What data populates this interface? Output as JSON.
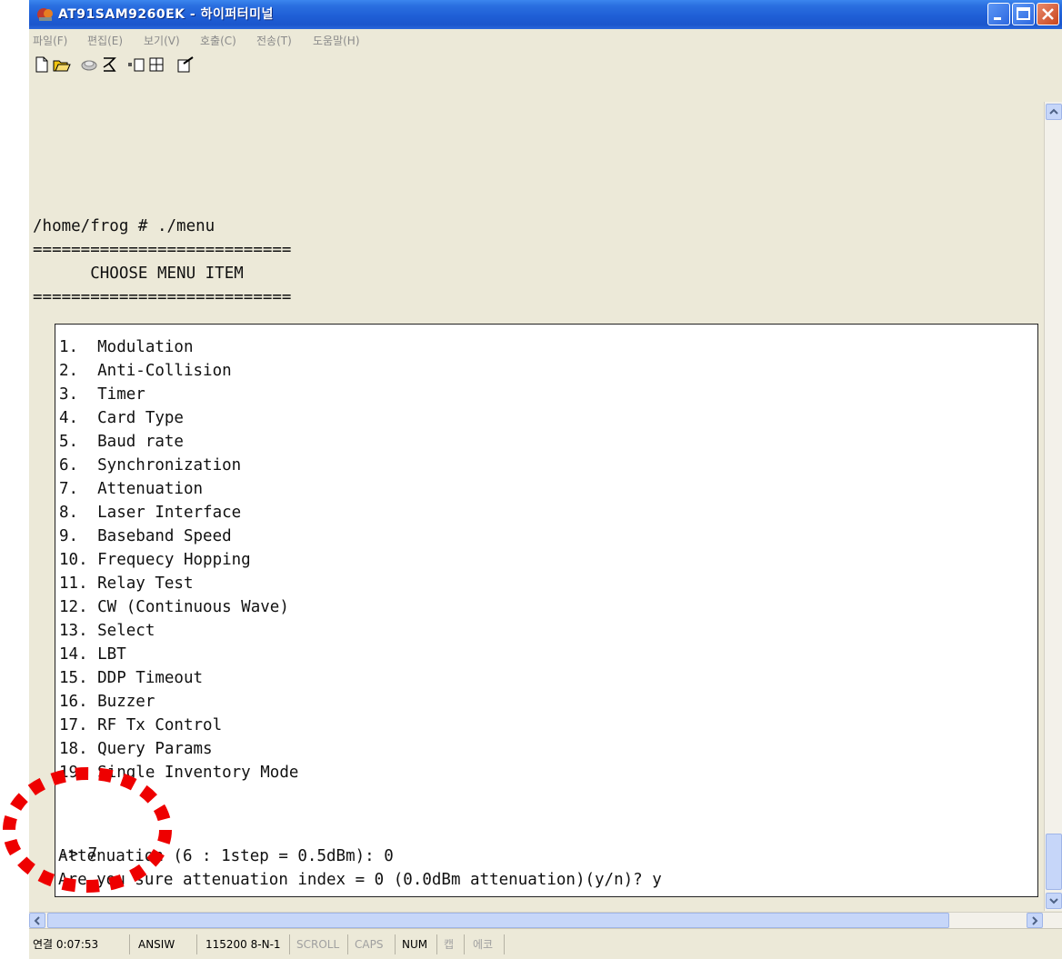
{
  "window": {
    "title": "AT91SAM9260EK - 하이퍼터미널",
    "colors": {
      "titlebar": "#1f5fd6",
      "annotation": "#ee0000"
    }
  },
  "menubar": [
    "파일(F)",
    "편집(E)",
    "보기(V)",
    "호출(C)",
    "전송(T)",
    "도움말(H)"
  ],
  "toolbar": [
    "new-icon",
    "open-icon",
    "disconnect-icon",
    "connect-icon",
    "send-icon",
    "receive-icon",
    "properties-icon"
  ],
  "terminal": {
    "header_lines": [
      "/home/frog # ./menu",
      "===========================",
      "      CHOOSE MENU ITEM",
      "==========================="
    ],
    "menu_items": [
      "1.  Modulation",
      "2.  Anti-Collision",
      "3.  Timer",
      "4.  Card Type",
      "5.  Baud rate",
      "6.  Synchronization",
      "7.  Attenuation",
      "8.  Laser Interface",
      "9.  Baseband Speed",
      "10. Frequecy Hopping",
      "11. Relay Test",
      "12. CW (Continuous Wave)",
      "13. Select",
      "14. LBT",
      "15. DDP Timeout",
      "16. Buzzer",
      "17. RF Tx Control",
      "18. Query Params",
      "19. Single Inventory Mode"
    ],
    "prompt_lines": [
      "-> 7",
      "Attenuation (6 : 1step = 0.5dBm): 0",
      "Are you sure attenuation index = 0 (0.0dBm attenuation)(y/n)? y"
    ]
  },
  "statusbar": {
    "connection": "연결 0:07:53",
    "emulation": "ANSIW",
    "settings": "115200 8-N-1",
    "scroll": "SCROLL",
    "caps": "CAPS",
    "num": "NUM",
    "capture": "캡",
    "echo": "에코"
  }
}
